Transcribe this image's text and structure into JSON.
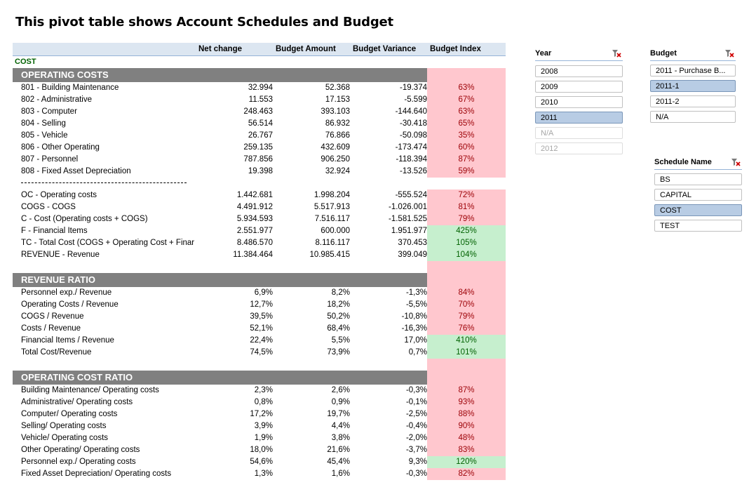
{
  "title": "This pivot table shows Account Schedules and Budget",
  "columns": [
    "Net change",
    "Budget Amount",
    "Budget Variance",
    "Budget Index"
  ],
  "cost_label": "COST",
  "sections": [
    {
      "header": "OPERATING COSTS",
      "rows": [
        {
          "label": "801 -  Building Maintenance",
          "v": [
            "32.994",
            "52.368",
            "-19.374",
            "63%"
          ],
          "s": "pink"
        },
        {
          "label": "802 -  Administrative",
          "v": [
            "11.553",
            "17.153",
            "-5.599",
            "67%"
          ],
          "s": "pink"
        },
        {
          "label": "803 -  Computer",
          "v": [
            "248.463",
            "393.103",
            "-144.640",
            "63%"
          ],
          "s": "pink"
        },
        {
          "label": "804 -  Selling",
          "v": [
            "56.514",
            "86.932",
            "-30.418",
            "65%"
          ],
          "s": "pink"
        },
        {
          "label": "805 -  Vehicle",
          "v": [
            "26.767",
            "76.866",
            "-50.098",
            "35%"
          ],
          "s": "pink"
        },
        {
          "label": "806 -  Other Operating",
          "v": [
            "259.135",
            "432.609",
            "-173.474",
            "60%"
          ],
          "s": "pink"
        },
        {
          "label": "807 -  Personnel",
          "v": [
            "787.856",
            "906.250",
            "-118.394",
            "87%"
          ],
          "s": "pink"
        },
        {
          "label": "808 -  Fixed Asset Depreciation",
          "v": [
            "19.398",
            "32.924",
            "-13.526",
            "59%"
          ],
          "s": "pink"
        },
        {
          "dash": true
        },
        {
          "label": "OC - Operating costs",
          "v": [
            "1.442.681",
            "1.998.204",
            "-555.524",
            "72%"
          ],
          "s": "pink"
        },
        {
          "label": "COGS - COGS",
          "v": [
            "4.491.912",
            "5.517.913",
            "-1.026.001",
            "81%"
          ],
          "s": "pink"
        },
        {
          "label": "C - Cost (Operating costs + COGS)",
          "v": [
            "5.934.593",
            "7.516.117",
            "-1.581.525",
            "79%"
          ],
          "s": "pink"
        },
        {
          "label": "F - Financial Items",
          "v": [
            "2.551.977",
            "600.000",
            "1.951.977",
            "425%"
          ],
          "s": "green"
        },
        {
          "label": "TC - Total Cost (COGS + Operating Cost + Finar",
          "v": [
            "8.486.570",
            "8.116.117",
            "370.453",
            "105%"
          ],
          "s": "green"
        },
        {
          "label": "REVENUE - Revenue",
          "v": [
            "11.384.464",
            "10.985.415",
            "399.049",
            "104%"
          ],
          "s": "green"
        },
        {
          "blank": true
        }
      ]
    },
    {
      "header": "REVENUE RATIO",
      "rows": [
        {
          "label": "Personnel exp./ Revenue",
          "v": [
            "6,9%",
            "8,2%",
            "-1,3%",
            "84%"
          ],
          "s": "pink"
        },
        {
          "label": "Operating Costs / Revenue",
          "v": [
            "12,7%",
            "18,2%",
            "-5,5%",
            "70%"
          ],
          "s": "pink"
        },
        {
          "label": "COGS / Revenue",
          "v": [
            "39,5%",
            "50,2%",
            "-10,8%",
            "79%"
          ],
          "s": "pink"
        },
        {
          "label": "Costs / Revenue",
          "v": [
            "52,1%",
            "68,4%",
            "-16,3%",
            "76%"
          ],
          "s": "pink"
        },
        {
          "label": "Financial Items / Revenue",
          "v": [
            "22,4%",
            "5,5%",
            "17,0%",
            "410%"
          ],
          "s": "green"
        },
        {
          "label": "Total Cost/Revenue",
          "v": [
            "74,5%",
            "73,9%",
            "0,7%",
            "101%"
          ],
          "s": "green"
        },
        {
          "blank": true
        }
      ]
    },
    {
      "header": "OPERATING COST RATIO",
      "rows": [
        {
          "label": "Building Maintenance/ Operating costs",
          "v": [
            "2,3%",
            "2,6%",
            "-0,3%",
            "87%"
          ],
          "s": "pink"
        },
        {
          "label": "Administrative/ Operating costs",
          "v": [
            "0,8%",
            "0,9%",
            "-0,1%",
            "93%"
          ],
          "s": "pink"
        },
        {
          "label": "Computer/ Operating costs",
          "v": [
            "17,2%",
            "19,7%",
            "-2,5%",
            "88%"
          ],
          "s": "pink"
        },
        {
          "label": "Selling/ Operating costs",
          "v": [
            "3,9%",
            "4,4%",
            "-0,4%",
            "90%"
          ],
          "s": "pink"
        },
        {
          "label": "Vehicle/ Operating costs",
          "v": [
            "1,9%",
            "3,8%",
            "-2,0%",
            "48%"
          ],
          "s": "pink"
        },
        {
          "label": "Other Operating/ Operating costs",
          "v": [
            "18,0%",
            "21,6%",
            "-3,7%",
            "83%"
          ],
          "s": "pink"
        },
        {
          "label": "Personnel exp./ Operating costs",
          "v": [
            "54,6%",
            "45,4%",
            "9,3%",
            "120%"
          ],
          "s": "green"
        },
        {
          "label": "Fixed Asset Depreciation/ Operating costs",
          "v": [
            "1,3%",
            "1,6%",
            "-0,3%",
            "82%"
          ],
          "s": "pink"
        }
      ]
    }
  ],
  "slicers": {
    "year": {
      "title": "Year",
      "items": [
        {
          "label": "2008",
          "state": "normal"
        },
        {
          "label": "2009",
          "state": "normal"
        },
        {
          "label": "2010",
          "state": "normal"
        },
        {
          "label": "2011",
          "state": "selected"
        },
        {
          "label": "N/A",
          "state": "dim"
        },
        {
          "label": "2012",
          "state": "dim"
        }
      ]
    },
    "budget": {
      "title": "Budget",
      "items": [
        {
          "label": "2011 - Purchase B...",
          "state": "normal"
        },
        {
          "label": "2011-1",
          "state": "selected"
        },
        {
          "label": "2011-2",
          "state": "normal"
        },
        {
          "label": "N/A",
          "state": "normal"
        }
      ]
    },
    "schedule": {
      "title": "Schedule Name",
      "items": [
        {
          "label": "BS",
          "state": "normal"
        },
        {
          "label": "CAPITAL",
          "state": "normal"
        },
        {
          "label": "COST",
          "state": "selected"
        },
        {
          "label": "TEST",
          "state": "normal"
        }
      ]
    }
  },
  "icons": {
    "clear_filter": "clear-filter-icon"
  }
}
